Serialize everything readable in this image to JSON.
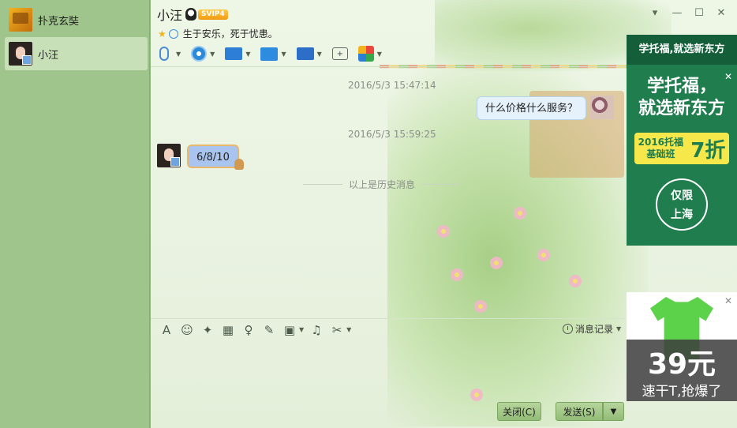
{
  "contacts": [
    {
      "name": "扑克玄奘",
      "active": false
    },
    {
      "name": "小汪",
      "active": true
    }
  ],
  "chat": {
    "title": "小汪",
    "badge": "SVIP4",
    "signature": "生于安乐，死于忧患。"
  },
  "window_controls": [
    "▾",
    "—",
    "☐",
    "✕"
  ],
  "toolbar_icons": [
    "microphone-icon",
    "video-camera-icon",
    "screen-share-icon",
    "file-transfer-icon",
    "remote-desktop-icon",
    "group-chat-icon",
    "apps-icon"
  ],
  "messages": [
    {
      "timestamp": "2016/5/3 15:47:14",
      "text": "什么价格什么服务？",
      "side": "right"
    },
    {
      "timestamp": "2016/5/3 15:59:25",
      "text": "6/8/10",
      "side": "left"
    }
  ],
  "history_divider": "以上是历史消息",
  "input_toolbar": {
    "font_icon": "A",
    "emoji_icon": "☺",
    "history_label": "消息记录"
  },
  "buttons": {
    "close": "关闭(C)",
    "send": "发送(S)",
    "send_caret": "▼"
  },
  "ads": {
    "ad1_header": "学托福,就选新东方",
    "ad1_line1": "学托福，",
    "ad1_line2": "就选新东方",
    "ad1_small1": "2016托福",
    "ad1_small2": "基础班",
    "ad1_discount": "7折",
    "ad1_seal1": "仅限",
    "ad1_seal2": "上海",
    "ad2_price": "39元",
    "ad2_slogan": "速干T,抢爆了",
    "close_glyph": "✕"
  }
}
